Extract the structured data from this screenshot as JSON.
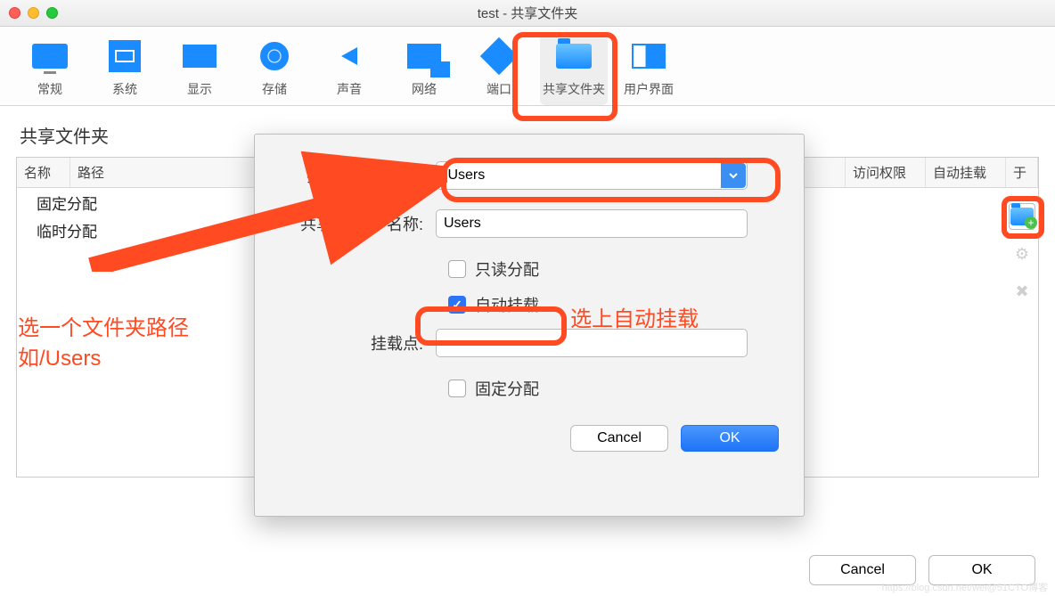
{
  "window": {
    "title": "test - 共享文件夹"
  },
  "toolbar": {
    "items": [
      {
        "label": "常规"
      },
      {
        "label": "系统"
      },
      {
        "label": "显示"
      },
      {
        "label": "存储"
      },
      {
        "label": "声音"
      },
      {
        "label": "网络"
      },
      {
        "label": "端口"
      },
      {
        "label": "共享文件夹"
      },
      {
        "label": "用户界面"
      }
    ]
  },
  "section_title": "共享文件夹",
  "table": {
    "cols": {
      "name": "名称",
      "path": "路径",
      "perm": "访问权限",
      "auto": "自动挂载",
      "at": "于"
    },
    "rows": [
      "固定分配",
      "临时分配"
    ]
  },
  "dialog": {
    "labels": {
      "path": "共享文件夹路径:",
      "name": "共享文件     名称:",
      "readonly": "只读分配",
      "automount": "自动挂载",
      "mountpoint": "挂载点:",
      "fixed": "固定分配"
    },
    "values": {
      "path": "/Users",
      "name": "Users",
      "mountpoint": ""
    },
    "checks": {
      "readonly": false,
      "automount": true,
      "fixed": false
    },
    "buttons": {
      "cancel": "Cancel",
      "ok": "OK"
    }
  },
  "footer": {
    "cancel": "Cancel",
    "ok": "OK"
  },
  "annotations": {
    "select_path": "选一个文件夹路径如/Users",
    "auto_mount": "选上自动挂载"
  },
  "watermark": "https://blog.csdn.net/wei@51CTO博客"
}
